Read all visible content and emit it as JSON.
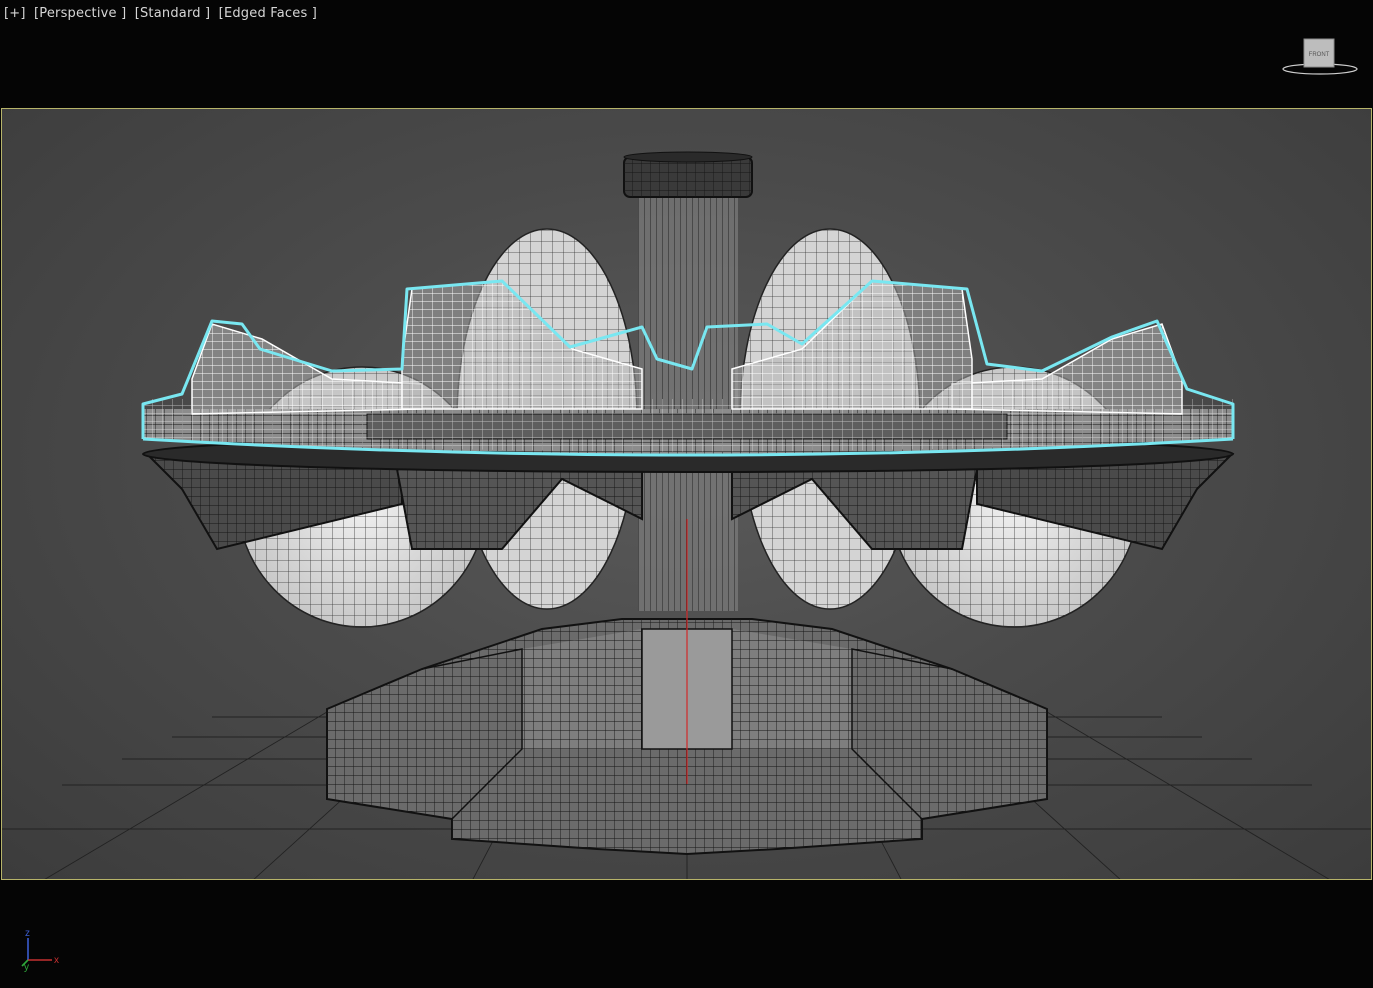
{
  "viewport": {
    "labels": [
      "[+]",
      "[Perspective ]",
      "[Standard ]",
      "[Edged Faces ]"
    ]
  },
  "viewcube": {
    "face": "FRONT"
  },
  "axis_tripod": {
    "z": "z",
    "y": "y",
    "x": "x"
  },
  "colors": {
    "background": "#050505",
    "viewport_bg": "#4b4b4b",
    "safe_frame": "#b7b46a",
    "selection_highlight": "#79e7f1",
    "wire_white": "#ffffff",
    "wire_dark": "#1a1a1a",
    "y_axis": "#d12a2a"
  }
}
